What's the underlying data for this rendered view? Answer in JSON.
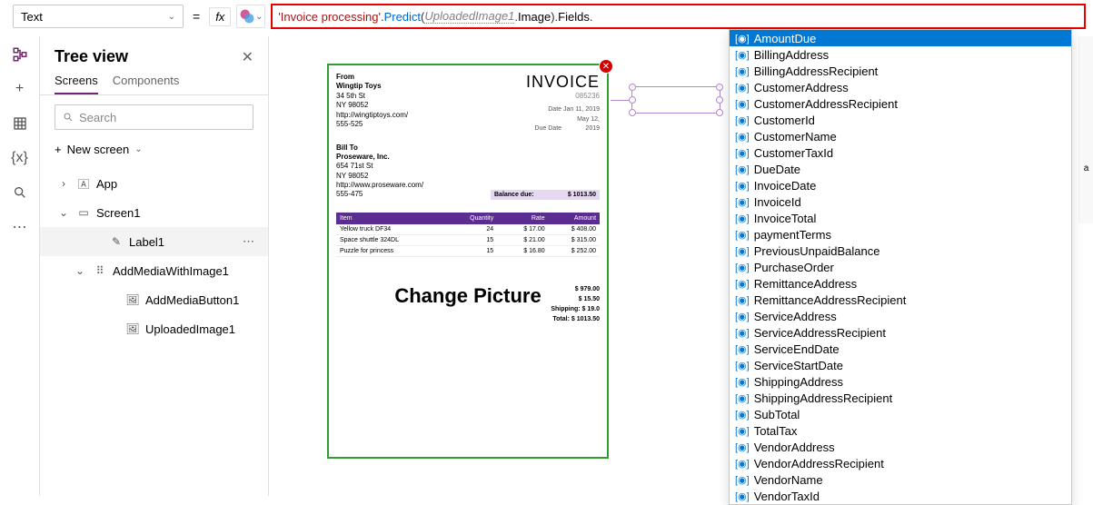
{
  "propertySelect": "Text",
  "formula": {
    "str": "'Invoice processing'",
    "fn1": "Predict",
    "arg": "UploadedImage1",
    "prop1": "Image",
    "prop2": "Fields"
  },
  "treeview": {
    "title": "Tree view",
    "tabs": [
      "Screens",
      "Components"
    ],
    "searchPlaceholder": "Search",
    "newScreen": "New screen",
    "items": [
      {
        "label": "App",
        "iconText": "🄰",
        "pad": "pad1",
        "expander": "›"
      },
      {
        "label": "Screen1",
        "iconText": "▭",
        "pad": "pad1",
        "expander": "⌄"
      },
      {
        "label": "Label1",
        "iconText": "✎",
        "pad": "pad3",
        "selected": true,
        "more": true
      },
      {
        "label": "AddMediaWithImage1",
        "iconText": "⠿",
        "pad": "pad2",
        "expander": "⌄"
      },
      {
        "label": "AddMediaButton1",
        "iconText": "🖼",
        "pad": "pad4"
      },
      {
        "label": "UploadedImage1",
        "iconText": "🖼",
        "pad": "pad4"
      }
    ]
  },
  "invoice": {
    "title": "INVOICE",
    "number": "085236",
    "fromHeader": "From",
    "from": [
      "Wingtip Toys",
      "34 5th St",
      "NY 98052",
      "http://wingtiptoys.com/",
      "555-525"
    ],
    "dateLabel": "Date",
    "date": "Jan 11, 2019",
    "dueLabel": "Due Date",
    "due": "May 12, 2019",
    "billToHeader": "Bill To",
    "billTo": [
      "Proseware, Inc.",
      "654 71st St",
      "NY 98052",
      "http://www.proseware.com/",
      "555-475"
    ],
    "balanceLabel": "Balance due:",
    "balance": "$ 1013.50",
    "headers": {
      "item": "Item",
      "qty": "Quantity",
      "rate": "Rate",
      "amt": "Amount"
    },
    "rows": [
      {
        "item": "Yellow truck DF34",
        "qty": "24",
        "rate": "$ 17.00",
        "amt": "$ 408.00"
      },
      {
        "item": "Space shuttle 324DL",
        "qty": "15",
        "rate": "$ 21.00",
        "amt": "$ 315.00"
      },
      {
        "item": "Puzzle for princess",
        "qty": "15",
        "rate": "$ 16.80",
        "amt": "$ 252.00"
      }
    ],
    "changePicture": "Change Picture",
    "totals": [
      {
        "l": "",
        "v": "$ 979.00"
      },
      {
        "l": "",
        "v": "$ 15.50"
      },
      {
        "l": "Shipping:",
        "v": "$ 19.0"
      },
      {
        "l": "Total:",
        "v": "$ 1013.50"
      }
    ]
  },
  "autocomplete": [
    "AmountDue",
    "BillingAddress",
    "BillingAddressRecipient",
    "CustomerAddress",
    "CustomerAddressRecipient",
    "CustomerId",
    "CustomerName",
    "CustomerTaxId",
    "DueDate",
    "InvoiceDate",
    "InvoiceId",
    "InvoiceTotal",
    "paymentTerms",
    "PreviousUnpaidBalance",
    "PurchaseOrder",
    "RemittanceAddress",
    "RemittanceAddressRecipient",
    "ServiceAddress",
    "ServiceAddressRecipient",
    "ServiceEndDate",
    "ServiceStartDate",
    "ShippingAddress",
    "ShippingAddressRecipient",
    "SubTotal",
    "TotalTax",
    "VendorAddress",
    "VendorAddressRecipient",
    "VendorName",
    "VendorTaxId"
  ]
}
